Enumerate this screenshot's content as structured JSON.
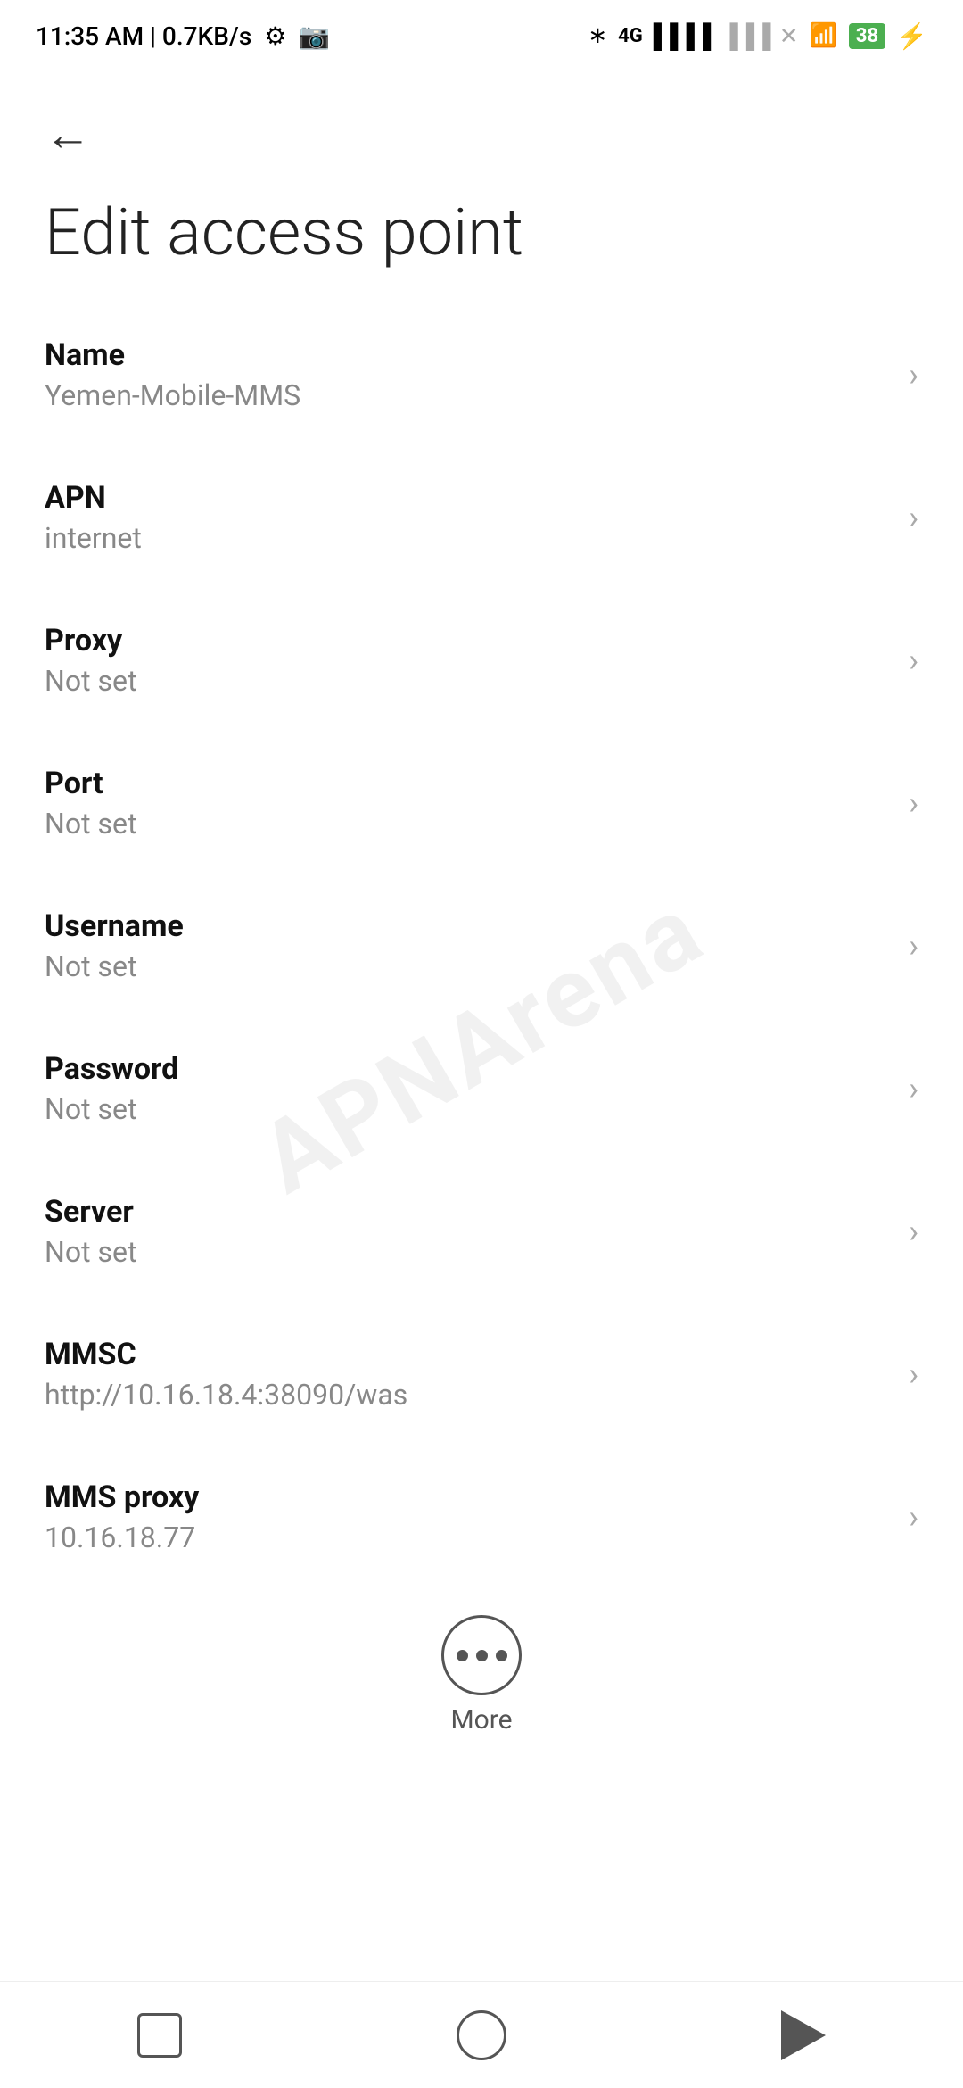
{
  "statusBar": {
    "time": "11:35 AM | 0.7KB/s",
    "settingsIcon": "⚙",
    "videoIcon": "▶",
    "bluetoothIcon": "B",
    "networkIcon": "4G",
    "wifiIcon": "WiFi",
    "batteryPercent": "38"
  },
  "header": {
    "backLabel": "←",
    "title": "Edit access point"
  },
  "items": [
    {
      "label": "Name",
      "value": "Yemen-Mobile-MMS"
    },
    {
      "label": "APN",
      "value": "internet"
    },
    {
      "label": "Proxy",
      "value": "Not set"
    },
    {
      "label": "Port",
      "value": "Not set"
    },
    {
      "label": "Username",
      "value": "Not set"
    },
    {
      "label": "Password",
      "value": "Not set"
    },
    {
      "label": "Server",
      "value": "Not set"
    },
    {
      "label": "MMSC",
      "value": "http://10.16.18.4:38090/was"
    },
    {
      "label": "MMS proxy",
      "value": "10.16.18.77"
    }
  ],
  "watermark": "APNArena",
  "more": {
    "label": "More"
  },
  "bottomNav": {
    "squareLabel": "Recent apps",
    "circleLabel": "Home",
    "triangleLabel": "Back"
  }
}
